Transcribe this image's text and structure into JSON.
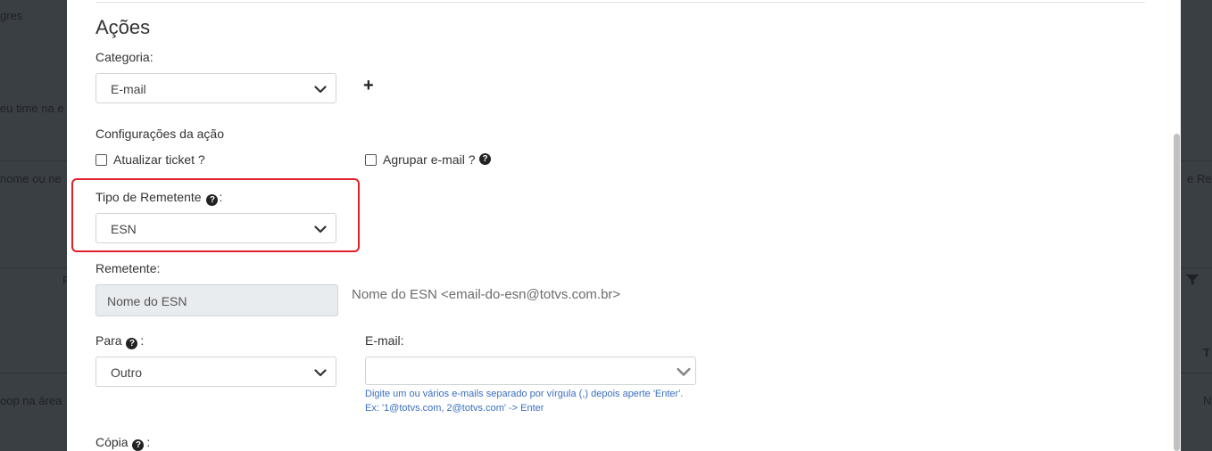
{
  "background": {
    "fragments": [
      "gres",
      "eu time na e",
      "nome ou ne",
      "F",
      "oop na área",
      "e Re",
      "T",
      "N"
    ]
  },
  "acoes": {
    "heading": "Ações",
    "categoria_label": "Categoria:",
    "categoria_value": "E-mail",
    "add_symbol": "+",
    "config_label": "Configurações da ação",
    "atualizar_ticket_label": "Atualizar ticket ?",
    "agrupar_email_label": "Agrupar e-mail ?",
    "tipo_remetente_label": "Tipo de Remetente",
    "tipo_remetente_suffix": ":",
    "tipo_remetente_value": "ESN",
    "remetente_label": "Remetente:",
    "remetente_value": "Nome do ESN",
    "remetente_preview": "Nome do ESN <email-do-esn@totvs.com.br>",
    "para_label": "Para",
    "para_suffix": " :",
    "para_value": "Outro",
    "email_label": "E-mail:",
    "email_value": "",
    "email_hint_line1": "Digite um ou vários e-mails separado por vírgula (,) depois aperte 'Enter'.",
    "email_hint_line2": "Ex: '1@totvs.com, 2@totvs.com' -> Enter",
    "copia_label": "Cópia",
    "copia_suffix": " :",
    "help_glyph": "?"
  },
  "colors": {
    "highlight": "#e0202a",
    "hint": "#3a6fbf",
    "overlay": "#3a3f44"
  }
}
